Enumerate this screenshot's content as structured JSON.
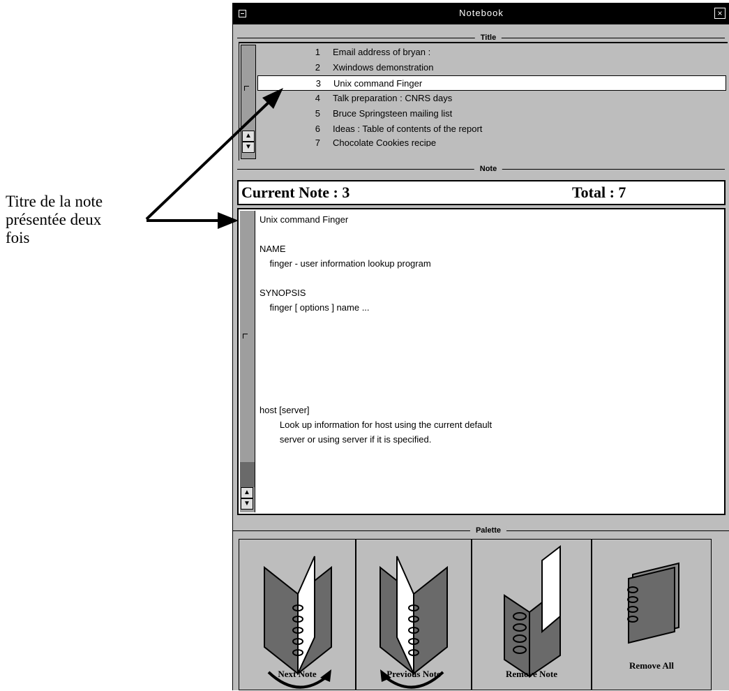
{
  "annotation": {
    "lines": [
      "Titre de la note",
      "présentée deux",
      "fois"
    ]
  },
  "window": {
    "title": "Notebook",
    "close_glyph": "×"
  },
  "groups": {
    "title_label": "Title",
    "note_label": "Note",
    "palette_label": "Palette"
  },
  "title_list": {
    "items": [
      {
        "num": "1",
        "text": "Email address of bryan :"
      },
      {
        "num": "2",
        "text": "Xwindows demonstration"
      },
      {
        "num": "3",
        "text": "Unix command Finger"
      },
      {
        "num": "4",
        "text": "Talk preparation : CNRS days"
      },
      {
        "num": "5",
        "text": "Bruce Springsteen mailing list"
      },
      {
        "num": "6",
        "text": "Ideas : Table of contents of the report"
      },
      {
        "num": "7",
        "text": "Chocolate Cookies recipe"
      }
    ],
    "selected_index": 2
  },
  "note": {
    "current_label": "Current Note : 3",
    "total_label": "Total : 7",
    "body": "Unix command Finger\n\nNAME\n    finger - user information lookup program\n\nSYNOPSIS\n    finger [ options ] name ...\n\n\n\n\n\n\nhost [server]\n        Look up information for host using the current default\n        server or using server if it is specified."
  },
  "palette": {
    "next_label": "Next Note",
    "previous_label": "Previous Note",
    "remove_label": "Remove Note",
    "remove_all_label": "Remove All"
  }
}
